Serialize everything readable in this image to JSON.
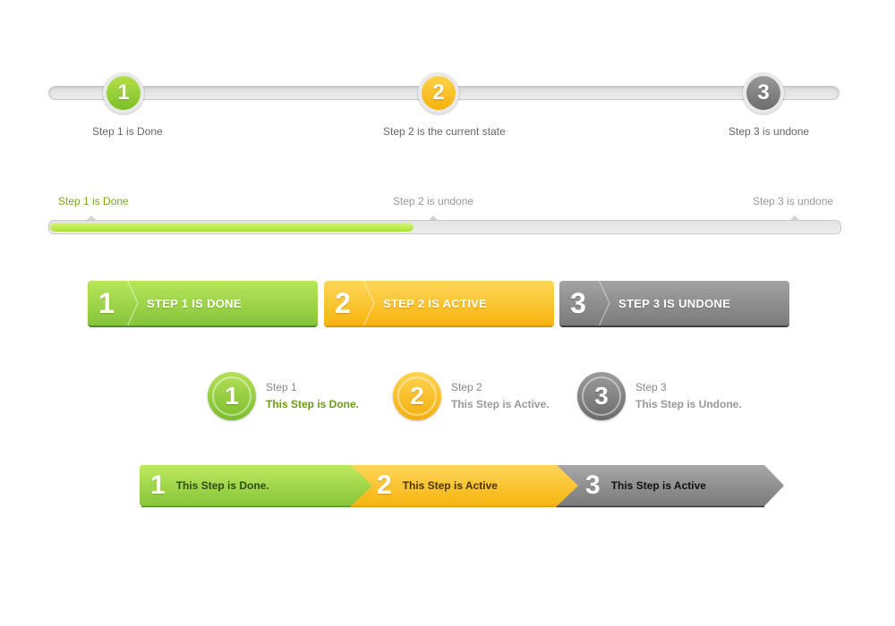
{
  "colors": {
    "done": "#8cc63f",
    "active": "#f7b915",
    "undone": "#7f7f7f",
    "done_text": "#6a9a14",
    "muted_text": "#999999"
  },
  "stepper_circles": {
    "steps": [
      {
        "number": "1",
        "label": "Step 1 is Done",
        "state": "done"
      },
      {
        "number": "2",
        "label": "Step 2 is the current state",
        "state": "active"
      },
      {
        "number": "3",
        "label": "Step 3 is undone",
        "state": "undone"
      }
    ]
  },
  "progress_bar": {
    "progress_percent": 46,
    "steps": [
      {
        "label": "Step 1 is Done",
        "state": "done"
      },
      {
        "label": "Step 2 is undone",
        "state": "undone"
      },
      {
        "label": "Step 3 is undone",
        "state": "undone"
      }
    ]
  },
  "tab_steps": {
    "steps": [
      {
        "number": "1",
        "label": "STEP 1 IS DONE",
        "state": "done"
      },
      {
        "number": "2",
        "label": "STEP 2 IS ACTIVE",
        "state": "active"
      },
      {
        "number": "3",
        "label": "STEP 3 IS UNDONE",
        "state": "undone"
      }
    ]
  },
  "circle_steps": {
    "steps": [
      {
        "number": "1",
        "title": "Step 1",
        "description": "This Step is Done.",
        "state": "done"
      },
      {
        "number": "2",
        "title": "Step 2",
        "description": "This Step is Active.",
        "state": "active"
      },
      {
        "number": "3",
        "title": "Step 3",
        "description": "This Step is Undone.",
        "state": "undone"
      }
    ]
  },
  "arrow_steps": {
    "steps": [
      {
        "number": "1",
        "label": "This Step is Done.",
        "state": "done"
      },
      {
        "number": "2",
        "label": "This Step is Active",
        "state": "active"
      },
      {
        "number": "3",
        "label": "This Step is Active",
        "state": "undone"
      }
    ]
  }
}
